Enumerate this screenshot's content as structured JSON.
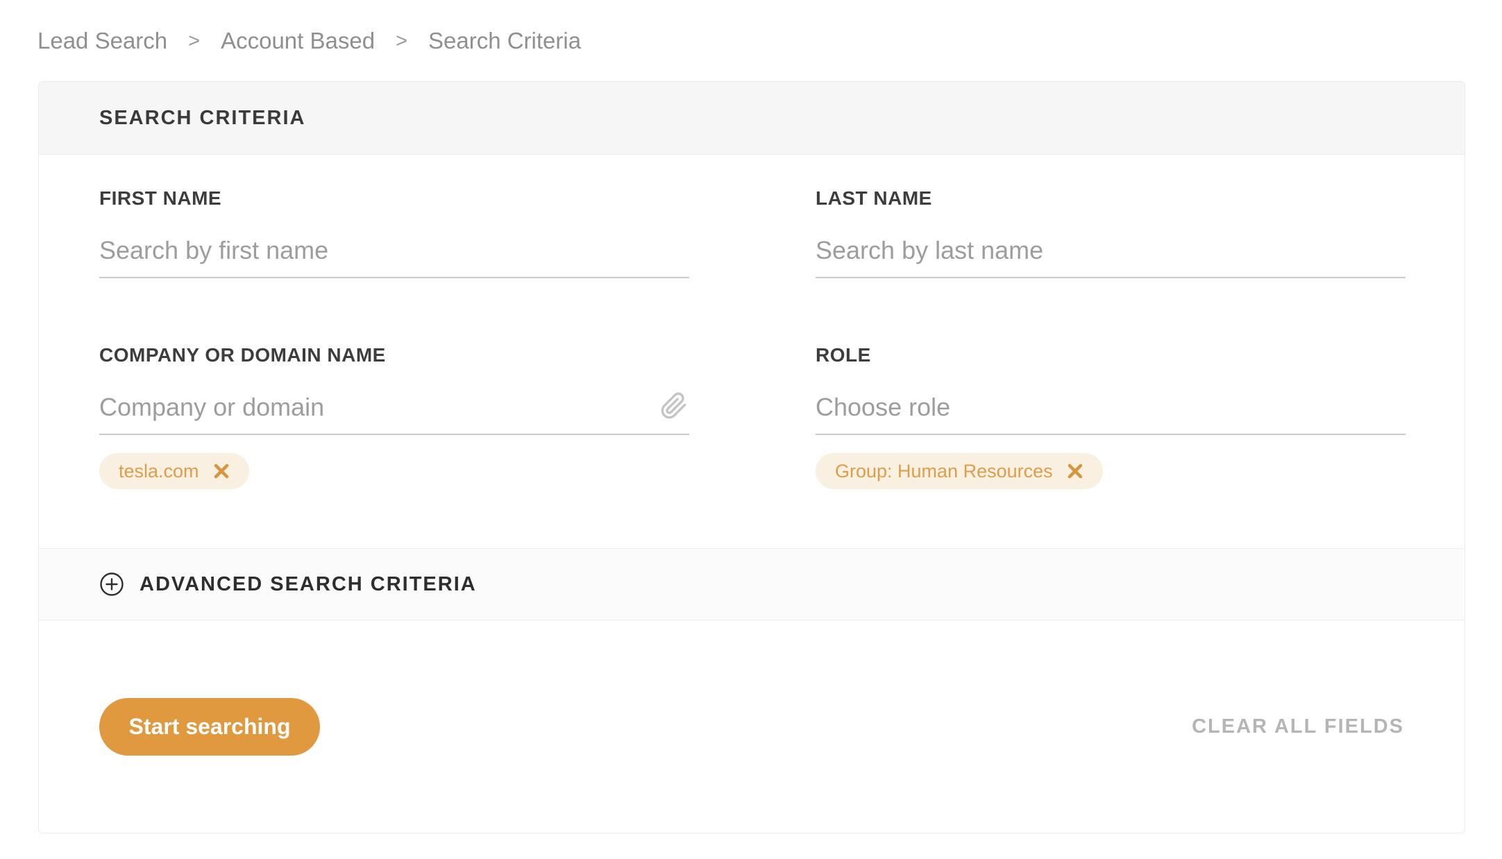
{
  "breadcrumb": {
    "separator": ">",
    "items": [
      {
        "label": "Lead Search"
      },
      {
        "label": "Account Based"
      },
      {
        "label": "Search Criteria"
      }
    ]
  },
  "card": {
    "header_title": "SEARCH CRITERIA",
    "fields": {
      "first_name": {
        "label": "FIRST NAME",
        "placeholder": "Search by first name",
        "value": ""
      },
      "last_name": {
        "label": "LAST NAME",
        "placeholder": "Search by last name",
        "value": ""
      },
      "company": {
        "label": "COMPANY OR DOMAIN NAME",
        "placeholder": "Company or domain",
        "value": "",
        "icon": "paperclip-icon",
        "tags": [
          {
            "label": "tesla.com"
          }
        ]
      },
      "role": {
        "label": "ROLE",
        "placeholder": "Choose role",
        "value": "",
        "tags": [
          {
            "label": "Group: Human Resources"
          }
        ]
      }
    },
    "advanced": {
      "label": "ADVANCED SEARCH CRITERIA",
      "icon": "plus-circle-icon"
    },
    "actions": {
      "start_button": "Start searching",
      "clear_link": "CLEAR ALL FIELDS"
    }
  },
  "colors": {
    "accent_orange": "#e0993e",
    "tag_background": "#faf0e1",
    "tag_text": "#dd9e4b",
    "header_band": "#f6f6f6",
    "advanced_band": "#fbfbfb",
    "card_border": "#ececec",
    "input_underline": "#cbcbcb",
    "label_text": "#3d3d3d",
    "placeholder_text": "#9d9d9d",
    "breadcrumb_text": "#8f8f8f",
    "clear_link_text": "#b5b5b5"
  }
}
